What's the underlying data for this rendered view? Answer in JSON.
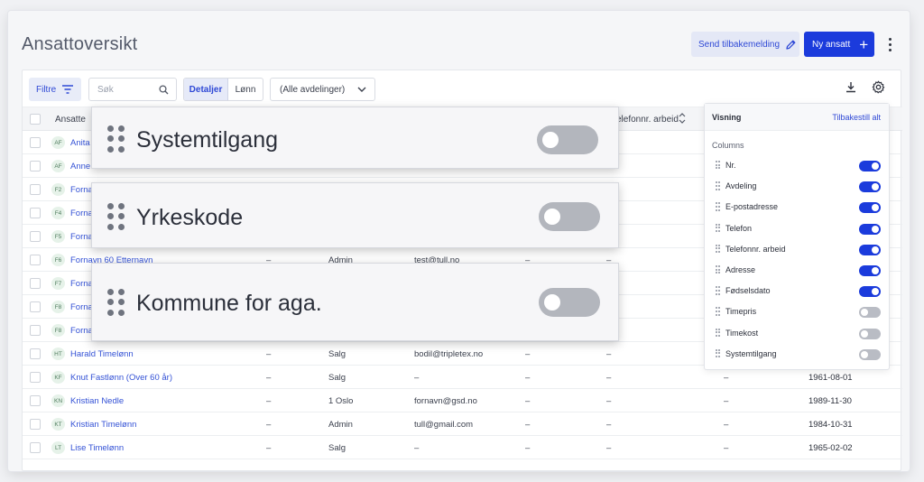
{
  "header": {
    "title": "Ansattoversikt",
    "feedback_label": "Send tilbakemelding",
    "new_employee_label": "Ny ansatt"
  },
  "toolbar": {
    "filter_label": "Filtre",
    "search_placeholder": "Søk",
    "details_label": "Detaljer",
    "salary_label": "Lønn",
    "department_value": "(Alle avdelinger)"
  },
  "table": {
    "columns": {
      "name": "Ansatte",
      "phone_work": "Telefonnr. arbeid"
    },
    "rows": [
      {
        "initials": "AF",
        "name": "Anita",
        "c1": "",
        "c2": "",
        "c3": "",
        "c4": "",
        "c5": "",
        "c6": "",
        "c7": ""
      },
      {
        "initials": "AF",
        "name": "Anne",
        "c1": "",
        "c2": "",
        "c3": "",
        "c4": "",
        "c5": "",
        "c6": "",
        "c7": ""
      },
      {
        "initials": "F2",
        "name": "Forna",
        "c1": "",
        "c2": "",
        "c3": "",
        "c4": "",
        "c5": "",
        "c6": "",
        "c7": ""
      },
      {
        "initials": "F4",
        "name": "Forna",
        "c1": "",
        "c2": "",
        "c3": "",
        "c4": "",
        "c5": "",
        "c6": "",
        "c7": ""
      },
      {
        "initials": "F5",
        "name": "Forna",
        "c1": "",
        "c2": "",
        "c3": "",
        "c4": "",
        "c5": "",
        "c6": "",
        "c7": ""
      },
      {
        "initials": "F6",
        "name": "Fornavn 60 Etternavn",
        "c1": "–",
        "c2": "Admin",
        "c3": "test@tull.no",
        "c4": "–",
        "c5": "–",
        "c6": "",
        "c7": ""
      },
      {
        "initials": "F7",
        "name": "Forna",
        "c1": "",
        "c2": "",
        "c3": "",
        "c4": "",
        "c5": "",
        "c6": "",
        "c7": ""
      },
      {
        "initials": "F8",
        "name": "Forna",
        "c1": "",
        "c2": "",
        "c3": "",
        "c4": "",
        "c5": "",
        "c6": "",
        "c7": ""
      },
      {
        "initials": "F8",
        "name": "Forna",
        "c1": "",
        "c2": "",
        "c3": "",
        "c4": "",
        "c5": "",
        "c6": "",
        "c7": ""
      },
      {
        "initials": "HT",
        "name": "Harald Timelønn",
        "c1": "–",
        "c2": "Salg",
        "c3": "bodil@tripletex.no",
        "c4": "–",
        "c5": "–",
        "c6": "",
        "c7": ""
      },
      {
        "initials": "KF",
        "name": "Knut Fastlønn (Over 60 år)",
        "c1": "–",
        "c2": "Salg",
        "c3": "–",
        "c4": "–",
        "c5": "–",
        "c6": "–",
        "c7": "1961-08-01"
      },
      {
        "initials": "KN",
        "name": "Kristian Nedle",
        "c1": "–",
        "c2": "1 Oslo",
        "c3": "fornavn@gsd.no",
        "c4": "–",
        "c5": "–",
        "c6": "–",
        "c7": "1989-11-30"
      },
      {
        "initials": "KT",
        "name": "Kristian Timelønn",
        "c1": "–",
        "c2": "Admin",
        "c3": "tull@gmail.com",
        "c4": "–",
        "c5": "–",
        "c6": "–",
        "c7": "1984-10-31"
      },
      {
        "initials": "LT",
        "name": "Lise Timelønn",
        "c1": "–",
        "c2": "Salg",
        "c3": "–",
        "c4": "–",
        "c5": "–",
        "c6": "–",
        "c7": "1965-02-02"
      }
    ]
  },
  "panel": {
    "title": "Visning",
    "reset_label": "Tilbakestill alt",
    "section_label": "Columns",
    "items": [
      {
        "label": "Nr.",
        "on": true
      },
      {
        "label": "Avdeling",
        "on": true
      },
      {
        "label": "E-postadresse",
        "on": true
      },
      {
        "label": "Telefon",
        "on": true
      },
      {
        "label": "Telefonnr. arbeid",
        "on": true
      },
      {
        "label": "Adresse",
        "on": true
      },
      {
        "label": "Fødselsdato",
        "on": true
      },
      {
        "label": "Timepris",
        "on": false
      },
      {
        "label": "Timekost",
        "on": false
      },
      {
        "label": "Systemtilgang",
        "on": false
      }
    ]
  },
  "zoom": [
    {
      "label": "Systemtilgang",
      "on": false
    },
    {
      "label": "Yrkeskode",
      "on": false
    },
    {
      "label": "Kommune for aga.",
      "on": false
    }
  ],
  "colors": {
    "primary": "#1b3bdc",
    "link": "#3452d6",
    "toggle_off": "#b9bcc4"
  }
}
